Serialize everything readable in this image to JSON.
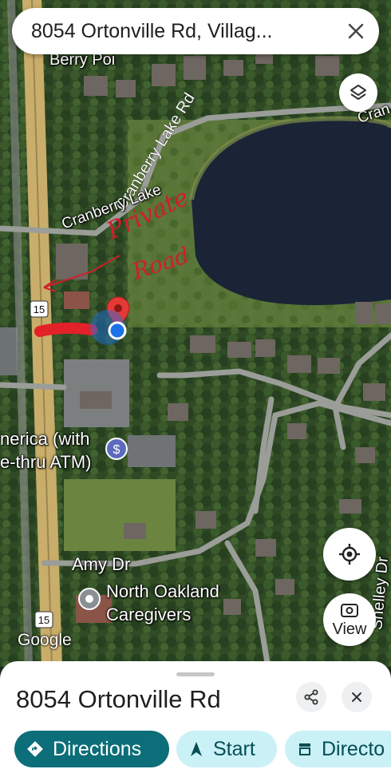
{
  "search": {
    "query": "8054 Ortonville Rd, Villag..."
  },
  "map": {
    "labels": {
      "berry_pointe": "Berry Poi",
      "cranberry_lake_rd_diag": "Cranberry Lake Rd",
      "cranberry_lake_rd": "Cranberry Lake",
      "cran": "Cran",
      "route_15_top": "15",
      "route_15_bottom": "15",
      "amy_dr": "Amy Dr",
      "shelley": "Shelley Dr",
      "bank_line1": "nerica (with",
      "bank_line2": "e-thru ATM)",
      "caregivers_line1": "North Oakland",
      "caregivers_line2": "Caregivers",
      "handwriting_line1": "Private",
      "handwriting_line2": "Road"
    },
    "attribution": "Google",
    "view_label": "View"
  },
  "sheet": {
    "title": "8054 Ortonville Rd",
    "actions": [
      {
        "label": "Directions",
        "icon": "directions-icon"
      },
      {
        "label": "Start",
        "icon": "navigation-arrow-icon"
      },
      {
        "label": "Directo",
        "icon": "storefront-icon"
      }
    ]
  },
  "colors": {
    "primary_chip": "#0b6e78",
    "secondary_chip": "#c9f1f6",
    "pin_red": "#e53935",
    "location_blue": "#1a73e8",
    "highway": "#c9ad6a",
    "water": "#1a2436"
  }
}
